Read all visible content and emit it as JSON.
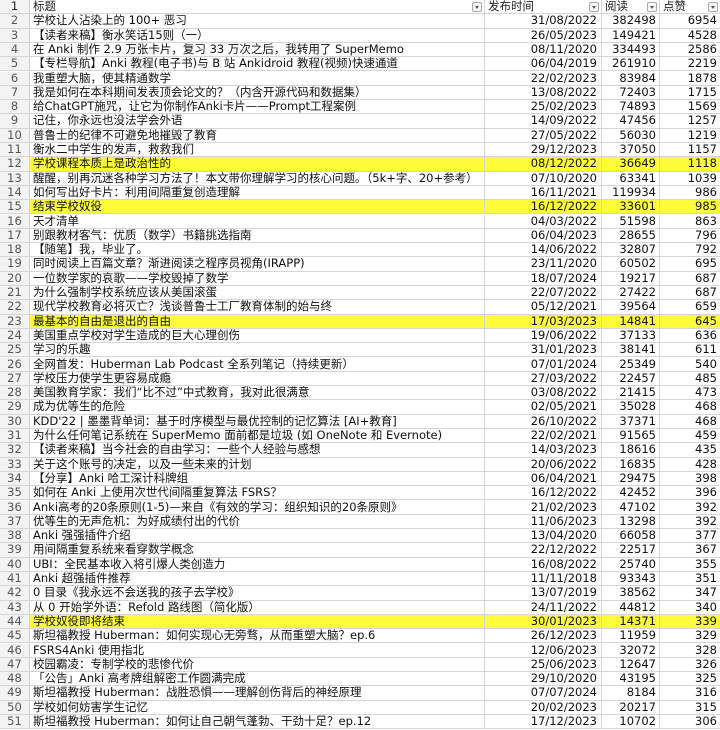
{
  "columns": {
    "title": "标题",
    "date": "发布时间",
    "reads": "阅读",
    "likes": "点赞"
  },
  "header_row_number": "1",
  "highlight_color": "#fcfc3a",
  "rows": [
    {
      "n": "2",
      "title": "学校让人沾染上的 100+ 恶习",
      "date": "31/08/2022",
      "reads": "382498",
      "likes": "6954",
      "hl": false
    },
    {
      "n": "3",
      "title": "【读者来稿】衡水笑话15则（一）",
      "date": "26/05/2023",
      "reads": "149421",
      "likes": "4528",
      "hl": false
    },
    {
      "n": "4",
      "title": "在 Anki 制作 2.9 万张卡片，复习 33 万次之后，我转用了 SuperMemo",
      "date": "08/11/2020",
      "reads": "334493",
      "likes": "2586",
      "hl": false
    },
    {
      "n": "5",
      "title": "【专栏导航】Anki 教程(电子书)与 B 站 Ankidroid 教程(视频)快速通道",
      "date": "06/04/2019",
      "reads": "261910",
      "likes": "2219",
      "hl": false
    },
    {
      "n": "6",
      "title": "我重塑大脑，使其精通数学",
      "date": "22/02/2023",
      "reads": "83984",
      "likes": "1878",
      "hl": false
    },
    {
      "n": "7",
      "title": "我是如何在本科期间发表顶会论文的？（内含开源代码和数据集）",
      "date": "13/08/2022",
      "reads": "72403",
      "likes": "1715",
      "hl": false
    },
    {
      "n": "8",
      "title": "给ChatGPT施咒，让它为你制作Anki卡片——Prompt工程案例",
      "date": "25/02/2023",
      "reads": "74893",
      "likes": "1569",
      "hl": false
    },
    {
      "n": "9",
      "title": "记住，你永远也没法学会外语",
      "date": "14/09/2022",
      "reads": "47456",
      "likes": "1257",
      "hl": false
    },
    {
      "n": "10",
      "title": "普鲁士的纪律不可避免地摧毁了教育",
      "date": "27/05/2022",
      "reads": "56030",
      "likes": "1219",
      "hl": false
    },
    {
      "n": "11",
      "title": "衡水二中学生的发声，救救我们",
      "date": "29/12/2023",
      "reads": "37050",
      "likes": "1157",
      "hl": false
    },
    {
      "n": "12",
      "title": "学校课程本质上是政治性的",
      "date": "08/12/2022",
      "reads": "36649",
      "likes": "1118",
      "hl": true
    },
    {
      "n": "13",
      "title": "醒醒，别再沉迷各种学习方法了！本文带你理解学习的核心问题。（5k+字、20+参考）",
      "date": "07/10/2020",
      "reads": "63341",
      "likes": "1039",
      "hl": false
    },
    {
      "n": "14",
      "title": "如何写出好卡片：利用间隔重复创造理解",
      "date": "16/11/2021",
      "reads": "119934",
      "likes": "986",
      "hl": false
    },
    {
      "n": "15",
      "title": "结束学校奴役",
      "date": "16/12/2022",
      "reads": "33601",
      "likes": "985",
      "hl": true
    },
    {
      "n": "16",
      "title": "天才清单",
      "date": "04/03/2022",
      "reads": "51598",
      "likes": "863",
      "hl": false
    },
    {
      "n": "17",
      "title": "别跟教材客气：优质（数学）书籍挑选指南",
      "date": "06/04/2023",
      "reads": "28655",
      "likes": "796",
      "hl": false
    },
    {
      "n": "18",
      "title": "【随笔】我，毕业了。",
      "date": "14/06/2022",
      "reads": "32807",
      "likes": "792",
      "hl": false
    },
    {
      "n": "19",
      "title": "同时阅读上百篇文章？渐进阅读之程序员视角(IRAPP)",
      "date": "23/11/2020",
      "reads": "60502",
      "likes": "695",
      "hl": false
    },
    {
      "n": "20",
      "title": "一位数学家的哀歌——学校毁掉了数学",
      "date": "18/07/2024",
      "reads": "19217",
      "likes": "687",
      "hl": false
    },
    {
      "n": "21",
      "title": "为什么强制学校系统应该从美国滚蛋",
      "date": "22/07/2022",
      "reads": "27422",
      "likes": "687",
      "hl": false
    },
    {
      "n": "22",
      "title": "现代学校教育必将灭亡？浅谈普鲁士工厂教育体制的始与终",
      "date": "05/12/2021",
      "reads": "39564",
      "likes": "659",
      "hl": false
    },
    {
      "n": "23",
      "title": "最基本的自由是退出的自由",
      "date": "17/03/2023",
      "reads": "14841",
      "likes": "645",
      "hl": true
    },
    {
      "n": "24",
      "title": "美国重点学校对学生造成的巨大心理创伤",
      "date": "19/06/2022",
      "reads": "37133",
      "likes": "636",
      "hl": false
    },
    {
      "n": "25",
      "title": "学习的乐趣",
      "date": "31/01/2023",
      "reads": "38141",
      "likes": "611",
      "hl": false
    },
    {
      "n": "26",
      "title": "全网首发：Huberman Lab Podcast 全系列笔记（持续更新）",
      "date": "07/01/2024",
      "reads": "25349",
      "likes": "540",
      "hl": false
    },
    {
      "n": "27",
      "title": "学校压力使学生更容易成瘾",
      "date": "27/03/2022",
      "reads": "22457",
      "likes": "485",
      "hl": false
    },
    {
      "n": "28",
      "title": "美国教育学家：我们“比不过”中式教育，我对此很满意",
      "date": "03/08/2022",
      "reads": "21415",
      "likes": "473",
      "hl": false
    },
    {
      "n": "29",
      "title": "成为优等生的危险",
      "date": "02/05/2021",
      "reads": "35028",
      "likes": "468",
      "hl": false
    },
    {
      "n": "30",
      "title": "KDD'22 | 墨墨背单词：基于时序模型与最优控制的记忆算法 [AI+教育]",
      "date": "26/10/2022",
      "reads": "37371",
      "likes": "468",
      "hl": false
    },
    {
      "n": "31",
      "title": "为什么任何笔记系统在 SuperMemo 面前都是垃圾 (如 OneNote 和 Evernote)",
      "date": "22/02/2021",
      "reads": "91565",
      "likes": "459",
      "hl": false
    },
    {
      "n": "32",
      "title": "【读者来稿】当今社会的自由学习：一些个人经验与感想",
      "date": "14/03/2023",
      "reads": "18616",
      "likes": "435",
      "hl": false
    },
    {
      "n": "33",
      "title": "关于这个账号的决定，以及一些未来的计划",
      "date": "20/06/2022",
      "reads": "16835",
      "likes": "428",
      "hl": false
    },
    {
      "n": "34",
      "title": "【分享】Anki 哈工深计科牌组",
      "date": "06/04/2021",
      "reads": "29475",
      "likes": "398",
      "hl": false
    },
    {
      "n": "35",
      "title": "如何在 Anki 上使用次世代间隔重复算法 FSRS？",
      "date": "16/12/2022",
      "reads": "42452",
      "likes": "396",
      "hl": false
    },
    {
      "n": "36",
      "title": "Anki高考的20条原则(1-5)—来自《有效的学习：组织知识的20条原则》",
      "date": "21/02/2023",
      "reads": "47102",
      "likes": "392",
      "hl": false
    },
    {
      "n": "37",
      "title": "优等生的无声危机：为好成绩付出的代价",
      "date": "11/06/2023",
      "reads": "13298",
      "likes": "392",
      "hl": false
    },
    {
      "n": "38",
      "title": "Anki 强强插件介绍",
      "date": "13/04/2020",
      "reads": "66058",
      "likes": "377",
      "hl": false
    },
    {
      "n": "39",
      "title": "用间隔重复系统来看穿数学概念",
      "date": "22/12/2022",
      "reads": "22517",
      "likes": "367",
      "hl": false
    },
    {
      "n": "40",
      "title": "UBI：全民基本收入将引爆人类创造力",
      "date": "16/08/2022",
      "reads": "25740",
      "likes": "355",
      "hl": false
    },
    {
      "n": "41",
      "title": "Anki 超强插件推荐",
      "date": "11/11/2018",
      "reads": "93343",
      "likes": "351",
      "hl": false
    },
    {
      "n": "42",
      "title": "0 目录《我永远不会送我的孩子去学校》",
      "date": "13/07/2019",
      "reads": "38562",
      "likes": "347",
      "hl": false
    },
    {
      "n": "43",
      "title": "从 0 开始学外语：Refold 路线图（简化版）",
      "date": "24/11/2022",
      "reads": "44812",
      "likes": "340",
      "hl": false
    },
    {
      "n": "44",
      "title": "学校奴役即将结束",
      "date": "30/01/2023",
      "reads": "14371",
      "likes": "339",
      "hl": true
    },
    {
      "n": "45",
      "title": "斯坦福教授 Huberman：如何实现心无旁骛，从而重塑大脑？ep.6",
      "date": "26/12/2023",
      "reads": "11959",
      "likes": "329",
      "hl": false
    },
    {
      "n": "46",
      "title": "FSRS4Anki 使用指北",
      "date": "12/06/2023",
      "reads": "32072",
      "likes": "328",
      "hl": false
    },
    {
      "n": "47",
      "title": "校园霸凌：专制学校的悲惨代价",
      "date": "25/06/2023",
      "reads": "12647",
      "likes": "326",
      "hl": false
    },
    {
      "n": "48",
      "title": "「公告」Anki 高考牌组解密工作圆满完成",
      "date": "29/10/2020",
      "reads": "43195",
      "likes": "325",
      "hl": false
    },
    {
      "n": "49",
      "title": "斯坦福教授 Huberman：战胜恐惧——理解创伤背后的神经原理",
      "date": "07/07/2024",
      "reads": "8184",
      "likes": "316",
      "hl": false
    },
    {
      "n": "50",
      "title": "学校如何妨害学生记忆",
      "date": "20/02/2023",
      "reads": "20217",
      "likes": "315",
      "hl": false
    },
    {
      "n": "51",
      "title": "斯坦福教授 Huberman：如何让自己朝气蓬勃、干劲十足？ep.12",
      "date": "17/12/2023",
      "reads": "10702",
      "likes": "306",
      "hl": false
    }
  ]
}
